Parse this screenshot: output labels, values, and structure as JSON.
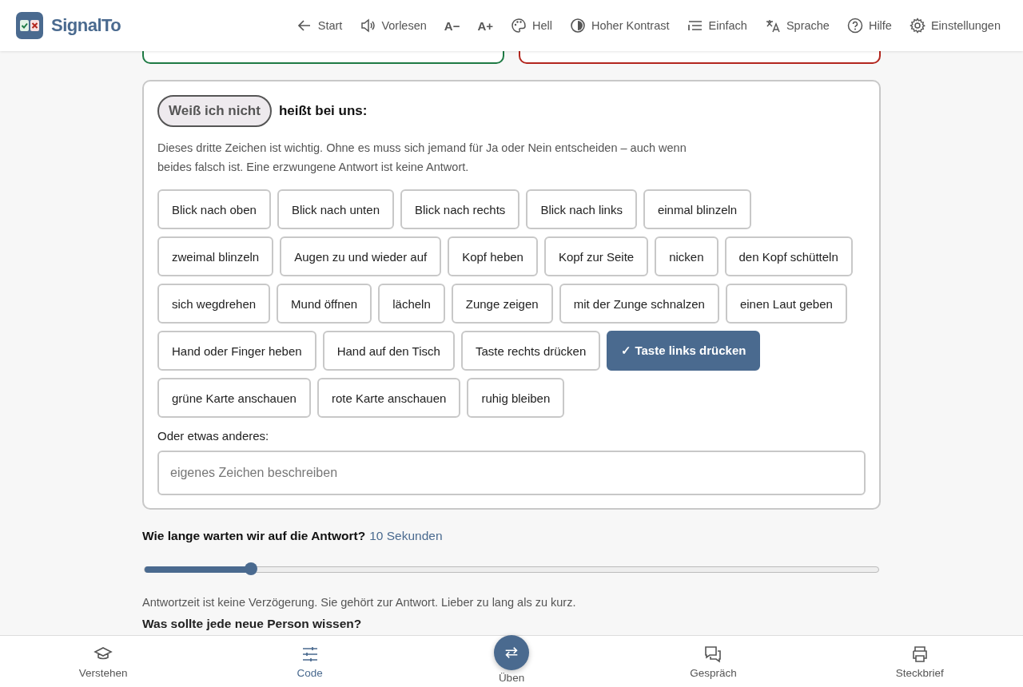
{
  "header": {
    "app_name": "SignalTo",
    "toolbar": [
      "Start",
      "Vorlesen",
      "A−",
      "A+",
      "Hell",
      "Hoher Kontrast",
      "Einfach",
      "Sprache",
      "Hilfe",
      "Einstellungen"
    ]
  },
  "top_cards": [
    {
      "color": "#1e7a44"
    },
    {
      "color": "#b3261e"
    }
  ],
  "signal_card": {
    "pill": "Weiß ich nicht",
    "heading": "heißt bei uns:",
    "description": "Dieses dritte Zeichen ist wichtig. Ohne es muss sich jemand für Ja oder Nein entscheiden – auch wenn beides falsch ist. Eine erzwungene Antwort ist keine Antwort.",
    "options": [
      {
        "label": "Blick nach oben",
        "selected": false
      },
      {
        "label": "Blick nach unten",
        "selected": false
      },
      {
        "label": "Blick nach rechts",
        "selected": false
      },
      {
        "label": "Blick nach links",
        "selected": false
      },
      {
        "label": "einmal blinzeln",
        "selected": false
      },
      {
        "label": "zweimal blinzeln",
        "selected": false
      },
      {
        "label": "Augen zu und wieder auf",
        "selected": false
      },
      {
        "label": "Kopf heben",
        "selected": false
      },
      {
        "label": "Kopf zur Seite",
        "selected": false
      },
      {
        "label": "nicken",
        "selected": false
      },
      {
        "label": "den Kopf schütteln",
        "selected": false
      },
      {
        "label": "sich wegdrehen",
        "selected": false
      },
      {
        "label": "Mund öffnen",
        "selected": false
      },
      {
        "label": "lächeln",
        "selected": false
      },
      {
        "label": "Zunge zeigen",
        "selected": false
      },
      {
        "label": "mit der Zunge schnalzen",
        "selected": false
      },
      {
        "label": "einen Laut geben",
        "selected": false
      },
      {
        "label": "Hand oder Finger heben",
        "selected": false
      },
      {
        "label": "Hand auf den Tisch",
        "selected": false
      },
      {
        "label": "Taste rechts drücken",
        "selected": false
      },
      {
        "label": "✓ Taste links drücken",
        "selected": true
      },
      {
        "label": "grüne Karte anschauen",
        "selected": false
      },
      {
        "label": "rote Karte anschauen",
        "selected": false
      },
      {
        "label": "ruhig bleiben",
        "selected": false
      }
    ],
    "other_label": "Oder etwas anderes:",
    "other_field": {
      "placeholder": "eigenes Zeichen beschreiben"
    }
  },
  "wait": {
    "question": "Wie lange warten wir auf die Antwort?",
    "value": "10 Sekunden",
    "level": 0.145,
    "note": "Antwortzeit ist keine Verzögerung. Sie gehört zur Antwort. Lieber zu lang als zu kurz."
  },
  "next_heading": "Was sollte jede neue Person wissen?",
  "bottom_nav": [
    {
      "label": "Verstehen",
      "kind": "tab",
      "selected": false
    },
    {
      "label": "Code",
      "kind": "tab",
      "selected": true
    },
    {
      "label": "Üben",
      "kind": "fab",
      "selected": false
    },
    {
      "label": "Gespräch",
      "kind": "tab",
      "selected": false
    },
    {
      "label": "Steckbrief",
      "kind": "tab",
      "selected": false
    }
  ]
}
